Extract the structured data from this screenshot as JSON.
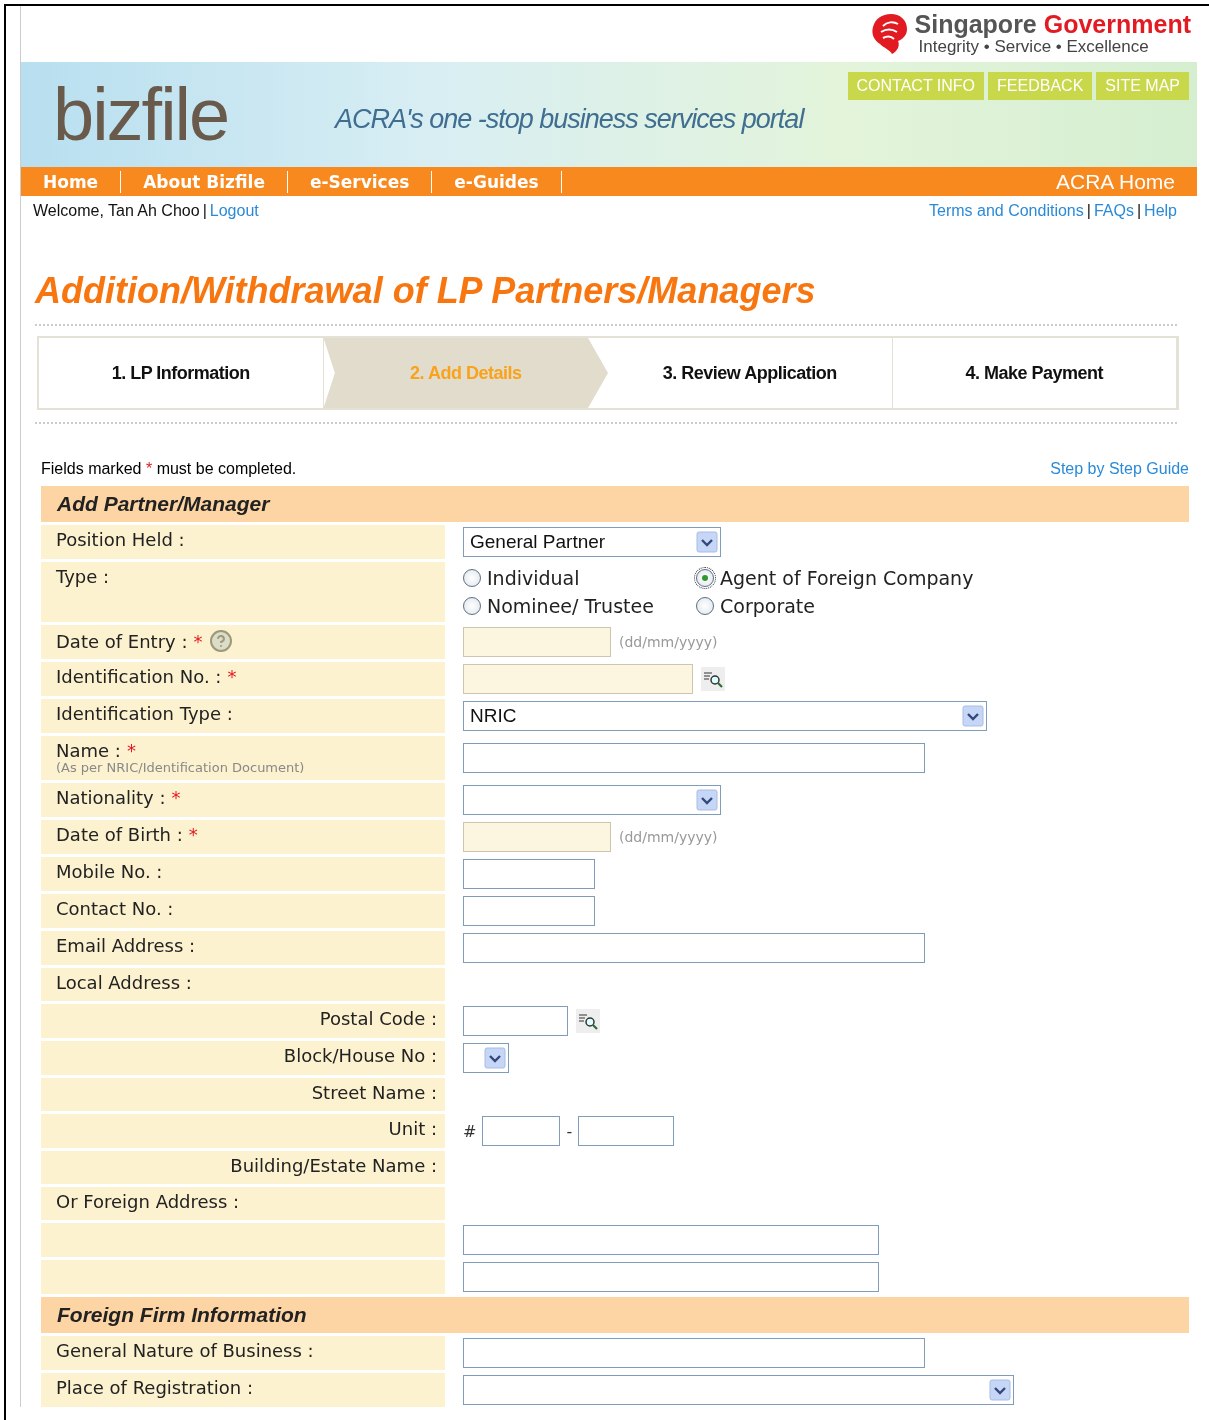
{
  "gov_logo": {
    "name_first": "Singapore",
    "name_second": "Government",
    "tagline": "Integrity • Service • Excellence"
  },
  "banner": {
    "logo": "bizfile",
    "slogan": "ACRA's one -stop business services portal",
    "links": [
      "CONTACT INFO",
      "FEEDBACK",
      "SITE MAP"
    ]
  },
  "nav": {
    "items": [
      "Home",
      "About Bizfile",
      "e-Services",
      "e-Guides"
    ],
    "home_link": "ACRA Home"
  },
  "user_bar": {
    "left": [
      {
        "kind": "text",
        "text": "Welcome, Tan Ah Choo"
      },
      {
        "kind": "separator",
        "text": "|"
      },
      {
        "kind": "link",
        "text": "Logout"
      }
    ],
    "right": [
      {
        "kind": "link",
        "text": "Terms and Conditions"
      },
      {
        "kind": "separator",
        "text": "|"
      },
      {
        "kind": "link",
        "text": "FAQs"
      },
      {
        "kind": "separator",
        "text": "|"
      },
      {
        "kind": "link",
        "text": "Help"
      }
    ]
  },
  "page_title": "Addition/Withdrawal of LP Partners/Managers",
  "steps": [
    {
      "label": "1. LP Information",
      "selected": false
    },
    {
      "label": "2. Add Details",
      "selected": true
    },
    {
      "label": "3. Review Application",
      "selected": false
    },
    {
      "label": "4. Make Payment",
      "selected": false
    }
  ],
  "required_note": {
    "before": "Fields marked",
    "mark": "*",
    "after": "must be completed."
  },
  "guide_link": "Step by Step Guide",
  "sections": [
    {
      "title": "Add Partner/Manager",
      "rows": [
        {
          "kind": "select",
          "label": "Position Held :",
          "value": "General Partner",
          "indented": false
        },
        {
          "kind": "radio",
          "label": "Type :",
          "indented": false,
          "options": [
            {
              "label": "Individual",
              "selected": false
            },
            {
              "label": "Agent of Foreign Company",
              "selected": true
            },
            {
              "label": "Nominee/ Trustee",
              "selected": false
            },
            {
              "label": "Corporate",
              "selected": false
            }
          ]
        },
        {
          "kind": "date",
          "label": "Date of Entry :",
          "required_mark": "*",
          "help": true,
          "disabled": true,
          "hint": "(dd/mm/yyyy)",
          "indented": false
        },
        {
          "kind": "lookup",
          "label": "Identification No. :",
          "required_mark": "*",
          "disabled": true,
          "indented": false
        },
        {
          "kind": "wideselect",
          "label": "Identification Type :",
          "value": "NRIC",
          "indented": false
        },
        {
          "kind": "longfield",
          "label": "Name :",
          "required_mark": "*",
          "note": "(As per NRIC/Identification Document)",
          "disabled": false,
          "indented": false
        },
        {
          "kind": "select",
          "label": "Nationality :",
          "required_mark": "*",
          "indented": false
        },
        {
          "kind": "date",
          "label": "Date of Birth :",
          "required_mark": "*",
          "help": false,
          "disabled": true,
          "hint": "(dd/mm/yyyy)",
          "indented": false
        },
        {
          "kind": "shortfield",
          "label": "Mobile No. :",
          "disabled": false,
          "indented": false
        },
        {
          "kind": "shortfield",
          "label": "Contact No. :",
          "disabled": false,
          "indented": false
        },
        {
          "kind": "longfield",
          "label": "Email Address :",
          "disabled": false,
          "indented": false
        },
        {
          "kind": "heading",
          "label": "Local Address :",
          "indented": false
        },
        {
          "kind": "postcode",
          "label": "Postal Code :",
          "indented": true,
          "disabled": false
        },
        {
          "kind": "tinyselect",
          "label": "Block/House No :",
          "indented": true
        },
        {
          "kind": "none",
          "label": "Street Name :",
          "indented": true
        },
        {
          "kind": "unit",
          "label": "Unit :",
          "indented": true,
          "hash": "#",
          "dash": "-"
        },
        {
          "kind": "none",
          "label": "Building/Estate Name :",
          "indented": true
        },
        {
          "kind": "heading",
          "label": "Or Foreign Address :",
          "indented": false
        },
        {
          "kind": "addressfield",
          "disabled": false
        },
        {
          "kind": "addressfield",
          "disabled": false
        }
      ]
    },
    {
      "title": "Foreign Firm Information",
      "rows": [
        {
          "kind": "longfield",
          "label": "General Nature of Business :",
          "disabled": false,
          "indented": false
        },
        {
          "kind": "fullselect",
          "label": "Place of Registration :",
          "indented": false
        }
      ]
    }
  ]
}
